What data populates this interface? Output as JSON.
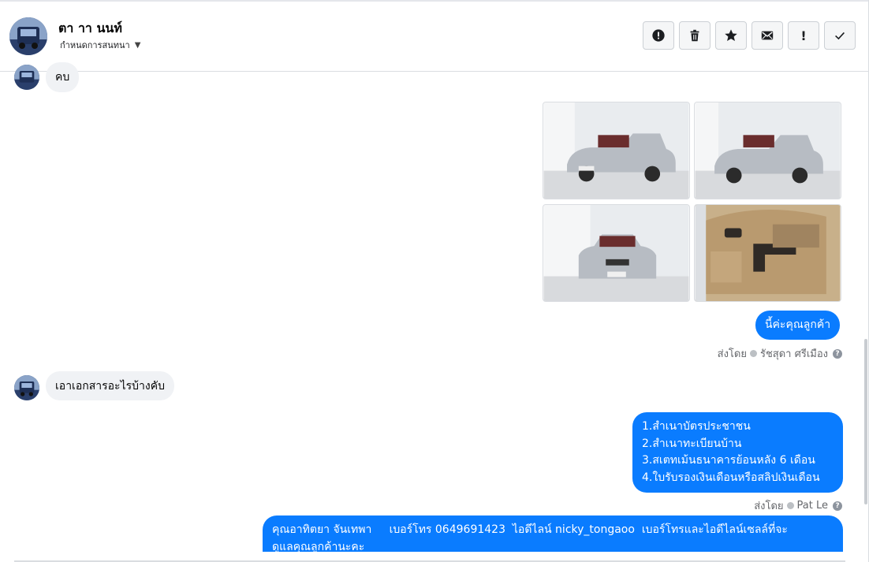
{
  "header": {
    "contact_name": "ตา าา นนท์",
    "subtitle": "กำหนดการสนทนา",
    "caret_icon": "caret-down-icon",
    "actions": [
      {
        "name": "report-button",
        "icon": "alert-circle-icon"
      },
      {
        "name": "delete-button",
        "icon": "trash-icon"
      },
      {
        "name": "star-button",
        "icon": "star-icon"
      },
      {
        "name": "mark-unread-button",
        "icon": "envelope-icon"
      },
      {
        "name": "mark-important-button",
        "icon": "exclamation-icon",
        "label": "!"
      },
      {
        "name": "mark-done-button",
        "icon": "checkmark-icon"
      }
    ]
  },
  "messages": {
    "m1_text": "คบ",
    "photos": [
      "car-photo-front-left",
      "car-photo-front-left-2",
      "car-photo-front",
      "car-photo-door-panel"
    ],
    "m2_text": "นี้ค่ะคุณลูกค้า",
    "m2_sent_prefix": "ส่งโดย",
    "m2_sender": "รัชสุดา ศรีเมือง",
    "m3_text": "เอาเอกสารอะไรบ้างคับ",
    "m4_lines": [
      "1.สำเนาบัตรประชาชน",
      "2.สำเนาทะเบียนบ้าน",
      "3.สเตทเม้นธนาคารย้อนหลัง 6 เดือน",
      "4.ใบรับรองเงินเดือนหรือสลิปเงินเดือน"
    ],
    "m4_sent_prefix": "ส่งโดย",
    "m4_sender": "Pat Le",
    "m5_line1": "คุณอาทิตยา จันเทพา     เบอร์โทร 0649691423  ไอดีไลน์ nicky_tongaoo  เบอร์โทรและไอดีไลน์เซลล์ที่จะ",
    "m5_line2": "ดูแลคุณลูกค้านะคะ"
  },
  "colors": {
    "outgoing_bubble": "#0a7cff",
    "incoming_bubble": "#f0f2f5",
    "meta_text": "#65676b"
  }
}
